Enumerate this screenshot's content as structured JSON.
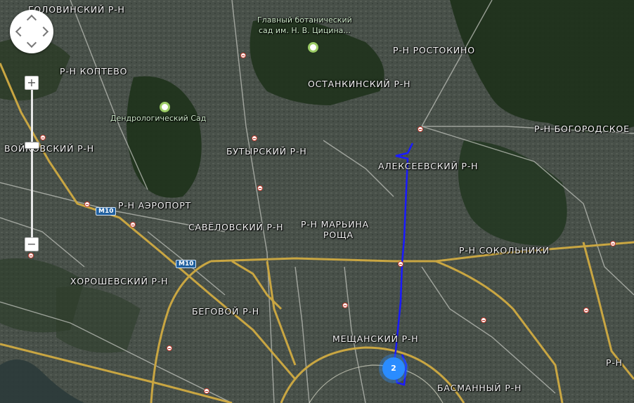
{
  "map": {
    "type": "satellite",
    "district_labels": [
      "Головинский р-н",
      "Р-Н КОПТЕВО",
      "Р-Н РОСТОКИНО",
      "ОСТАНКИНСКИЙ Р-Н",
      "Р-Н БОГОРОДСКОЕ",
      "ВОЙКОВСКИЙ Р-Н",
      "БУТЫРСКИЙ Р-Н",
      "АЛЕКСЕЕВСКИЙ Р-Н",
      "Р-Н АЭРОПОРТ",
      "САВЁЛОВСКИЙ Р-Н",
      "Р-Н МАРЬИНА",
      "РОЩА",
      "Р-Н СОКОЛЬНИКИ",
      "ХОРОШЕВСКИЙ Р-Н",
      "БЕГОВОЙ Р-Н",
      "МЕЩАНСКИЙ Р-Н",
      "БАСМАННЫЙ Р-Н",
      "Р-Н"
    ],
    "poi_labels": {
      "botanic_line1": "Главный ботанический",
      "botanic_line2": "сад им. Н. В. Цицина...",
      "dendro": "Дендрологический Сад"
    },
    "road_shields": [
      "M10",
      "M10"
    ],
    "cluster_count": "2"
  },
  "controls": {
    "zoom_in": "+",
    "zoom_out": "−"
  },
  "colors": {
    "route": "#1a1aff",
    "cluster": "#2a8cff",
    "ring_road": "#c9a642"
  }
}
